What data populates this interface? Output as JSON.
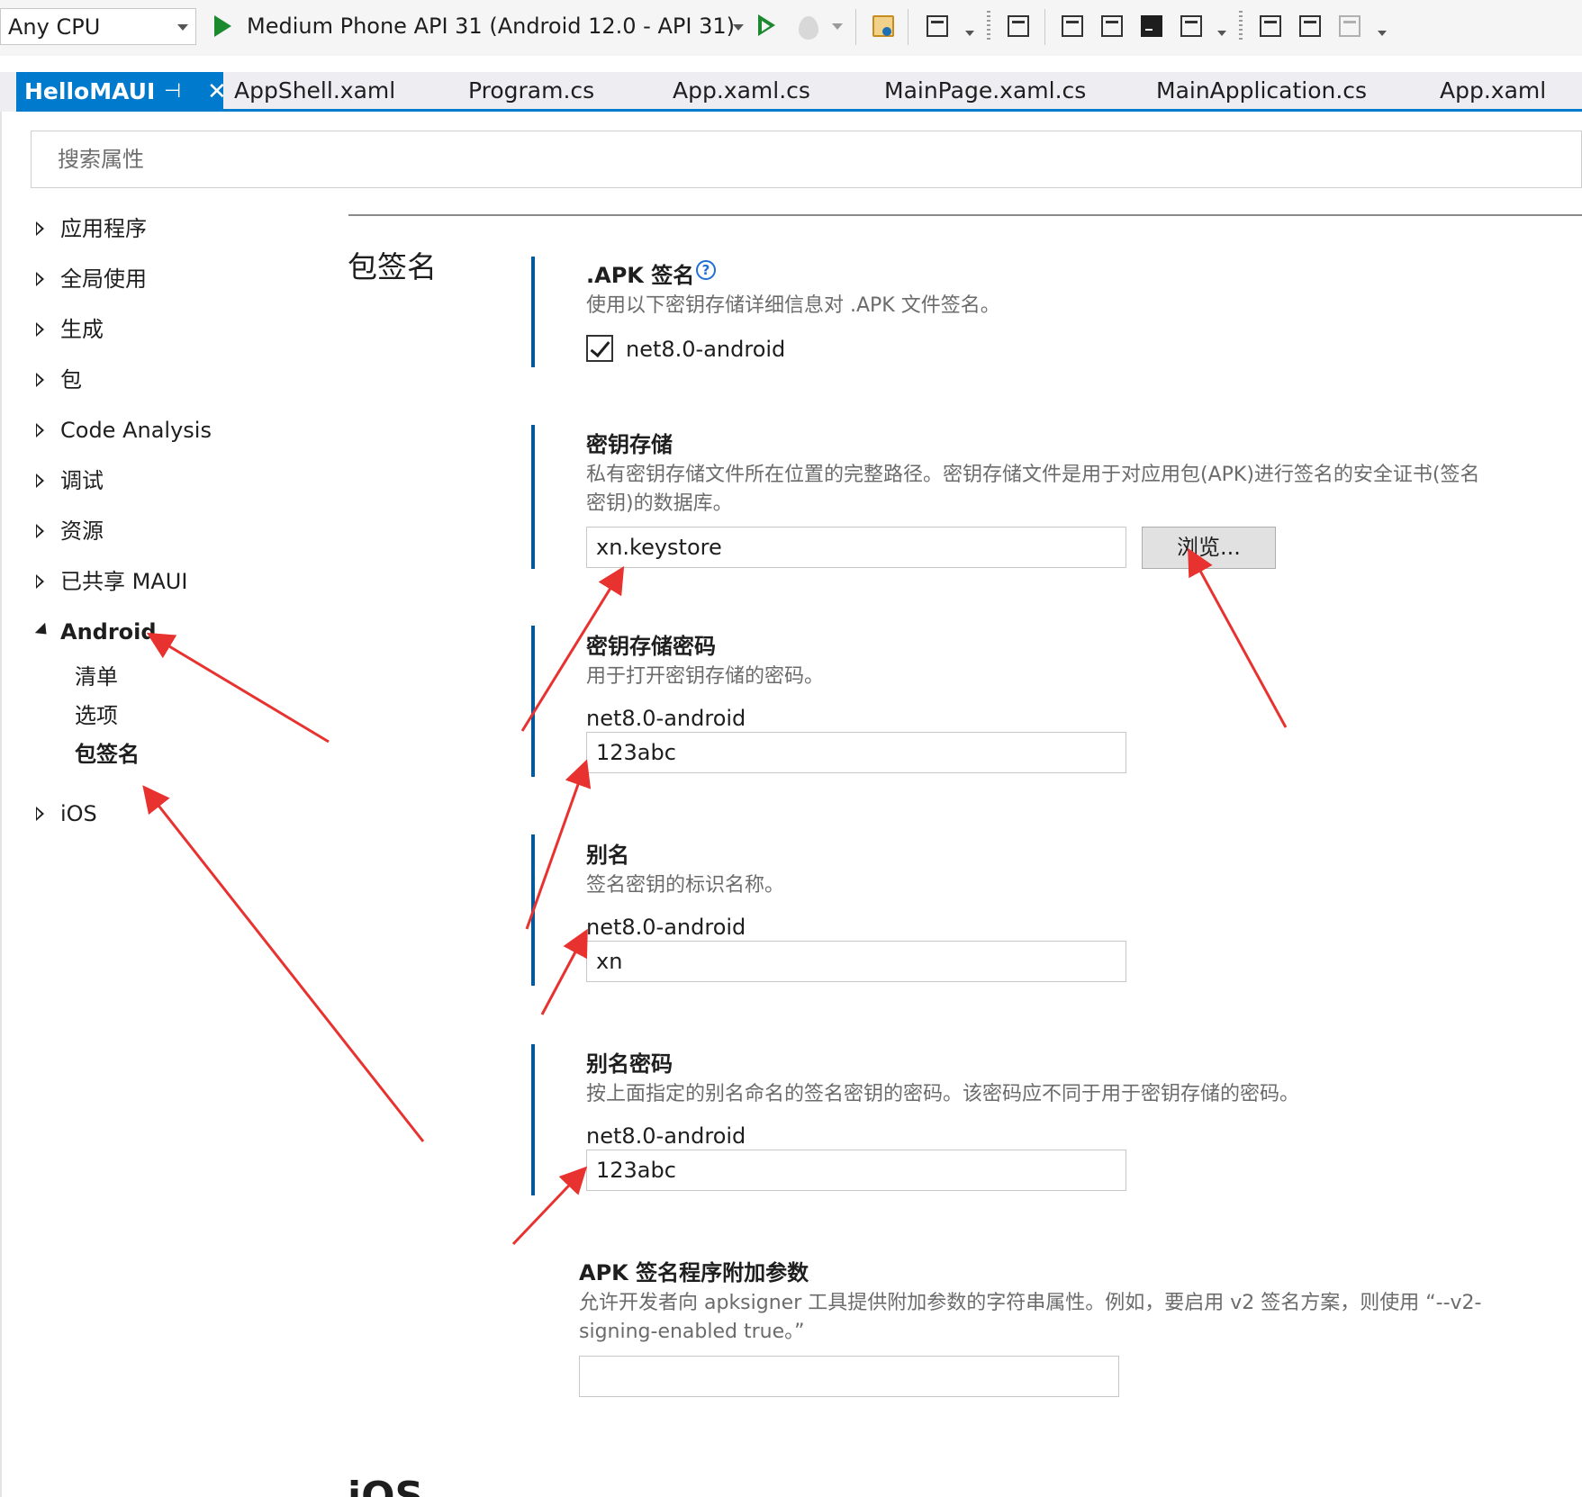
{
  "toolbar": {
    "platform": "Any CPU",
    "run_target": "Medium Phone API 31 (Android 12.0 - API 31)",
    "icons": [
      "play-outline-icon",
      "hot-reload-icon",
      "folder-search-icon",
      "window-icon",
      "device-copy-icon",
      "device-arrow-icon",
      "package-icon",
      "terminal-icon",
      "layout-icon",
      "monitor-icon",
      "panel-icon",
      "package-gray-icon"
    ]
  },
  "tabs": {
    "active": "HelloMAUI",
    "items": [
      "AppShell.xaml",
      "Program.cs",
      "App.xaml.cs",
      "MainPage.xaml.cs",
      "MainApplication.cs",
      "App.xaml"
    ]
  },
  "search": {
    "placeholder": "搜索属性"
  },
  "nav": {
    "items": [
      "应用程序",
      "全局使用",
      "生成",
      "包",
      "Code Analysis",
      "调试",
      "资源",
      "已共享 MAUI"
    ],
    "android": "Android",
    "android_children": [
      "清单",
      "选项",
      "包签名"
    ],
    "ios": "iOS"
  },
  "main": {
    "section_title": "包签名",
    "apk_sign": {
      "title": ".APK 签名",
      "desc": "使用以下密钥存储详细信息对 .APK 文件签名。",
      "checkbox_label": "net8.0-android",
      "checked": true
    },
    "keystore": {
      "title": "密钥存储",
      "desc": "私有密钥存储文件所在位置的完整路径。密钥存储文件是用于对应用包(APK)进行签名的安全证书(签名密钥)的数据库。",
      "value": "xn.keystore",
      "browse": "浏览..."
    },
    "keystore_password": {
      "title": "密钥存储密码",
      "desc": "用于打开密钥存储的密码。",
      "label": "net8.0-android",
      "value": "123abc"
    },
    "alias": {
      "title": "别名",
      "desc": "签名密钥的标识名称。",
      "label": "net8.0-android",
      "value": "xn"
    },
    "alias_password": {
      "title": "别名密码",
      "desc": "按上面指定的别名命名的签名密钥的密码。该密码应不同于用于密钥存储的密码。",
      "label": "net8.0-android",
      "value": "123abc"
    },
    "apksigner_args": {
      "title": "APK 签名程序附加参数",
      "desc": "允许开发者向 apksigner 工具提供附加参数的字符串属性。例如，要启用 v2 签名方案，则使用 “--v2-signing-enabled true。”",
      "value": ""
    },
    "next_section": "iOS"
  },
  "colors": {
    "accent": "#007acc",
    "section_bar": "#005a9e",
    "annotation_arrow": "#e8322f",
    "run_green": "#1b8a2e"
  }
}
